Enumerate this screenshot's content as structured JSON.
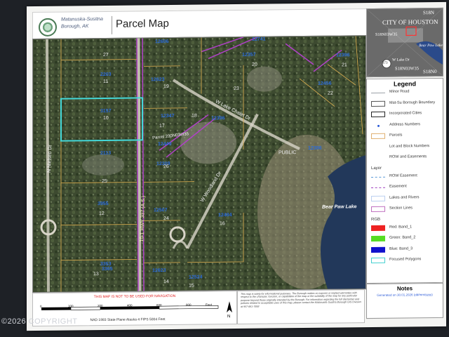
{
  "header": {
    "borough_name": "Matanuska-Susitna Borough, AK",
    "title": "Parcel Map"
  },
  "map": {
    "parcel_labels": [
      "3157",
      "2203",
      "2113",
      "3353",
      "12606",
      "12623",
      "12347",
      "12449",
      "12309",
      "12507",
      "12623",
      "12524",
      "12484",
      "12386",
      "12741",
      "12357",
      "12396",
      "12456",
      "12396",
      "3955",
      "3365"
    ],
    "lot_labels": [
      "10",
      "11",
      "12",
      "13",
      "14",
      "15",
      "16",
      "17",
      "18",
      "19",
      "20",
      "21",
      "22",
      "23",
      "24",
      "25",
      "26",
      "27"
    ],
    "roads": {
      "lake_road": "W Lake Chalet Dr",
      "parcel_note": "Parcel 230N03W35",
      "woodland": "W Woodland Dr",
      "nielson": "N Nielsen Dr",
      "state_hwy": "10-1 HWY 337 (A.S.)",
      "public": "PUBLIC"
    },
    "lake_label": "Bear Paw Lake"
  },
  "inset": {
    "city": "CITY OF HOUSTON",
    "s18n_top": "S18N",
    "s18n_bottom": "S18N0",
    "grid1": "S18N03W35",
    "grid2": "S18N03W35",
    "grid3": "S18N03W35",
    "lake": "Bear Paw Lake",
    "hwy": "W Lake Dr",
    "route": "373"
  },
  "legend": {
    "title": "Legend",
    "items": [
      {
        "label": "Minor Road",
        "type": "line",
        "color": "#9aa0a6"
      },
      {
        "label": "Mat-Su Borough Boundary",
        "type": "box",
        "color": "#555555"
      },
      {
        "label": "Incorporated Cities",
        "type": "box",
        "color": "#222222"
      },
      {
        "label": "Address Numbers",
        "type": "dot",
        "color": "#2a5ad8"
      },
      {
        "label": "Parcels",
        "type": "box",
        "color": "#e0b070"
      },
      {
        "label": "Lot and Block Numbers",
        "type": "none",
        "color": ""
      },
      {
        "label": "ROW and Easements",
        "type": "none",
        "color": ""
      },
      {
        "label": "Layer",
        "type": "header",
        "color": ""
      },
      {
        "label": "ROW Easement",
        "type": "dash",
        "color": "#5a9ad8"
      },
      {
        "label": "Easement",
        "type": "dash",
        "color": "#a040c0"
      },
      {
        "label": "Lakes and Rivers",
        "type": "box",
        "color": "#bcd0f0"
      },
      {
        "label": "Section Lines",
        "type": "box",
        "color": "#c070c0"
      },
      {
        "label": "RGB",
        "type": "header",
        "color": ""
      },
      {
        "label": "Red:  Band_1",
        "type": "fill",
        "color": "#ee2222"
      },
      {
        "label": "Green:  Band_2",
        "type": "fill",
        "color": "#55dd22"
      },
      {
        "label": "Blue:  Band_3",
        "type": "fill",
        "color": "#1111cc"
      },
      {
        "label": "Focused Polygons",
        "type": "box",
        "color": "#44d0d0"
      }
    ]
  },
  "notes": {
    "title": "Notes",
    "generated": "Generated on 30.01.2026 (dd/mm/yyyy)"
  },
  "scale": {
    "warning": "THIS MAP IS NOT TO BE USED FOR NAVIGATION",
    "ticks": [
      "0",
      "100",
      "200",
      "400",
      "600",
      "800"
    ],
    "unit": "Feet",
    "projection": "NAD 1983 State Plane Alaska 4 FIPS 5004 Feet",
    "north": "N"
  },
  "disclaimer": "This map is solely for informational purposes. The Borough makes no express or implied warranties with respect to the character, function, or capabilities of the map or the suitability of the map for any particular purpose beyond those originally intended by the Borough. For information regarding the full disclaimer and policies related to acceptable uses of this map, please contact the Matanuska-Susitna Borough GIS Division at 907-861-7858",
  "watermark": "©2026 COPYRIGHT"
}
